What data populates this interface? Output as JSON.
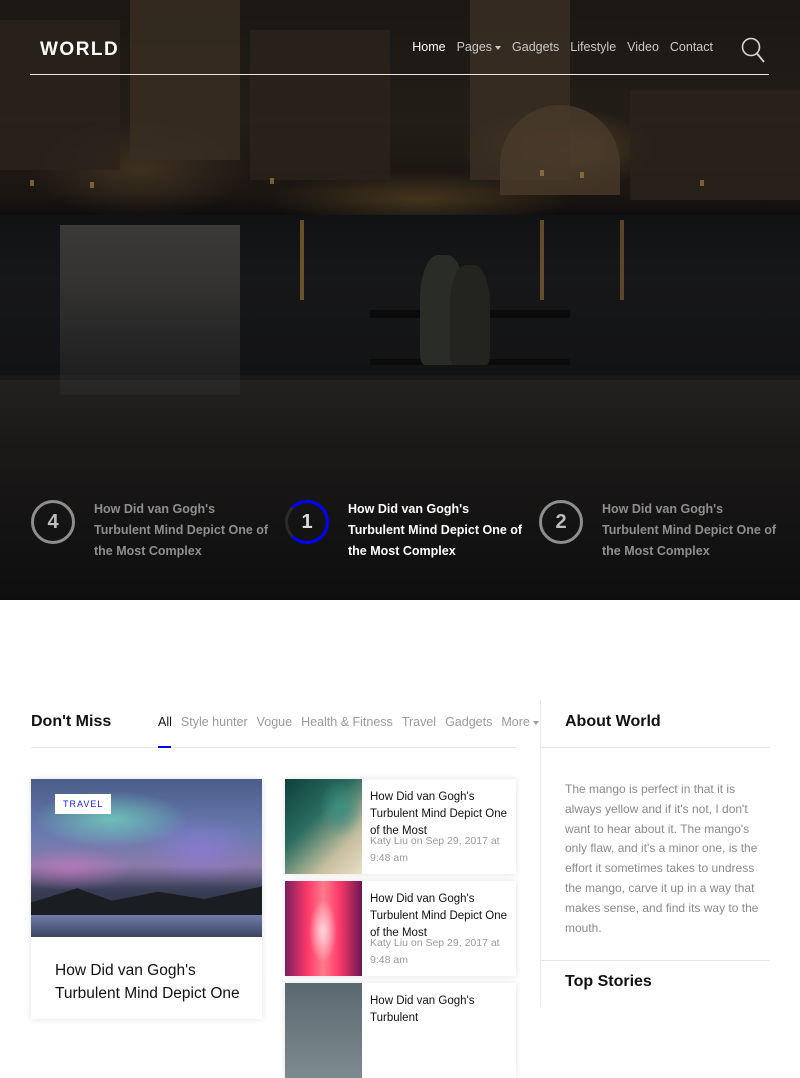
{
  "brand": "WORLD",
  "nav": {
    "items": [
      {
        "label": "Home",
        "active": true,
        "dropdown": false
      },
      {
        "label": "Pages",
        "active": false,
        "dropdown": true
      },
      {
        "label": "Gadgets",
        "active": false,
        "dropdown": false
      },
      {
        "label": "Lifestyle",
        "active": false,
        "dropdown": false
      },
      {
        "label": "Video",
        "active": false,
        "dropdown": false
      },
      {
        "label": "Contact",
        "active": false,
        "dropdown": false
      }
    ],
    "search_icon": "search-icon"
  },
  "hero": {
    "slides": [
      {
        "number": "4",
        "title": "How Did van Gogh's Turbulent Mind Depict One of the Most Complex",
        "current": false
      },
      {
        "number": "1",
        "title": "How Did van Gogh's Turbulent Mind Depict One of the Most Complex",
        "current": true
      },
      {
        "number": "2",
        "title": "How Did van Gogh's Turbulent Mind Depict One of the Most Complex",
        "current": false
      }
    ]
  },
  "dont_miss": {
    "title": "Don't Miss",
    "tabs": [
      {
        "label": "All",
        "active": true
      },
      {
        "label": "Style hunter",
        "active": false
      },
      {
        "label": "Vogue",
        "active": false
      },
      {
        "label": "Health & Fitness",
        "active": false
      },
      {
        "label": "Travel",
        "active": false
      },
      {
        "label": "Gadgets",
        "active": false
      },
      {
        "label": "More",
        "active": false,
        "dropdown": true
      }
    ],
    "featured": {
      "badge": "TRAVEL",
      "title": "How Did van Gogh's Turbulent Mind Depict One"
    },
    "list": [
      {
        "title": "How Did van Gogh's Turbulent Mind Depict One of the Most",
        "meta": "Katy Liu on Sep 29, 2017 at 9:48 am"
      },
      {
        "title": "How Did van Gogh's Turbulent Mind Depict One of the Most",
        "meta": "Katy Liu on Sep 29, 2017 at 9:48 am"
      },
      {
        "title": "How Did van Gogh's Turbulent",
        "meta": ""
      }
    ]
  },
  "about": {
    "title": "About World",
    "text": "The mango is perfect in that it is always yellow and if it's not, I don't want to hear about it. The mango's only flaw, and it's a minor one, is the effort it sometimes takes to undress the mango, carve it up in a way that makes sense, and find its way to the mouth."
  },
  "top_stories": {
    "title": "Top Stories"
  },
  "colors": {
    "accent": "#0000ff",
    "heading": "#111111",
    "muted": "#9a9a9a"
  }
}
